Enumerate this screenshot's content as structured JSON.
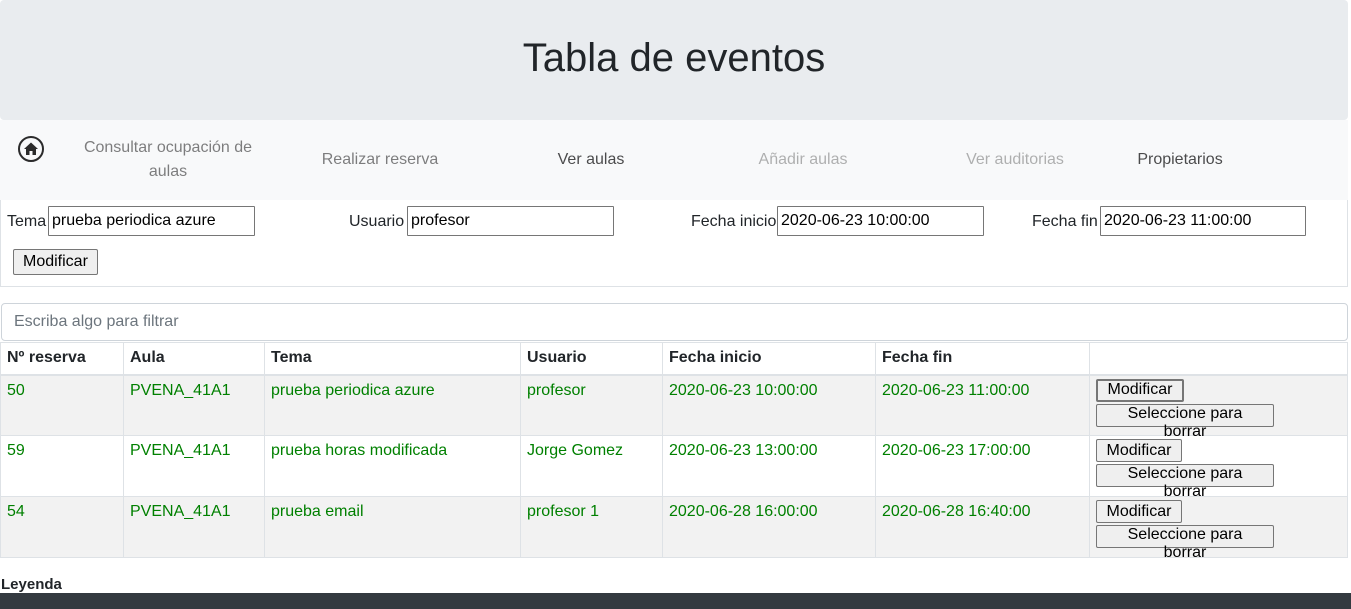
{
  "header": {
    "title": "Tabla de eventos"
  },
  "nav": {
    "home_icon": "home-icon",
    "items": [
      {
        "label": "Consultar ocupación de aulas",
        "state": "normal"
      },
      {
        "label": "Realizar reserva",
        "state": "normal"
      },
      {
        "label": "Ver aulas",
        "state": "active"
      },
      {
        "label": "Añadir aulas",
        "state": "disabled"
      },
      {
        "label": "Ver auditorias",
        "state": "disabled"
      },
      {
        "label": "Propietarios",
        "state": "active"
      }
    ]
  },
  "form": {
    "tema_label": "Tema",
    "tema_value": "prueba periodica azure",
    "usuario_label": "Usuario",
    "usuario_value": "profesor",
    "fecha_inicio_label": "Fecha inicio",
    "fecha_inicio_value": "2020-06-23 10:00:00",
    "fecha_fin_label": "Fecha fin",
    "fecha_fin_value": "2020-06-23 11:00:00",
    "submit_label": "Modificar"
  },
  "filter": {
    "placeholder": "Escriba algo para filtrar"
  },
  "table": {
    "columns": [
      "Nº reserva",
      "Aula",
      "Tema",
      "Usuario",
      "Fecha inicio",
      "Fecha fin",
      ""
    ],
    "rows": [
      {
        "id": "50",
        "aula": "PVENA_41A1",
        "tema": "prueba periodica azure",
        "usuario": "profesor",
        "inicio": "2020-06-23 10:00:00",
        "fin": "2020-06-23 11:00:00",
        "modify_label": "Modificar",
        "delete_label": "Seleccione para borrar"
      },
      {
        "id": "59",
        "aula": "PVENA_41A1",
        "tema": "prueba horas modificada",
        "usuario": "Jorge Gomez",
        "inicio": "2020-06-23 13:00:00",
        "fin": "2020-06-23 17:00:00",
        "modify_label": "Modificar",
        "delete_label": "Seleccione para borrar"
      },
      {
        "id": "54",
        "aula": "PVENA_41A1",
        "tema": "prueba email",
        "usuario": "profesor 1",
        "inicio": "2020-06-28 16:00:00",
        "fin": "2020-06-28 16:40:00",
        "modify_label": "Modificar",
        "delete_label": "Seleccione para borrar"
      }
    ],
    "row_text_color": "#008000"
  },
  "legend": {
    "title": "Leyenda"
  }
}
